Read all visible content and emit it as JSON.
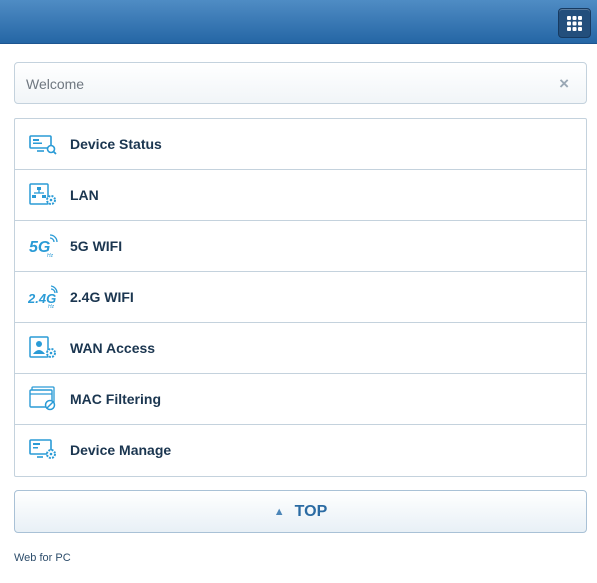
{
  "header": {
    "apps_icon": "grid-icon"
  },
  "welcome": {
    "text": "Welcome",
    "close": "×"
  },
  "menu": {
    "items": [
      {
        "label": "Device Status",
        "icon": "monitor-search-icon"
      },
      {
        "label": "LAN",
        "icon": "lan-gear-icon"
      },
      {
        "label": "5G WIFI",
        "icon": "wifi-5g-icon",
        "icon_text": "5G",
        "icon_sub": "Hz"
      },
      {
        "label": "2.4G WIFI",
        "icon": "wifi-24g-icon",
        "icon_text": "2.4G",
        "icon_sub": "Hz"
      },
      {
        "label": "WAN Access",
        "icon": "user-gear-icon"
      },
      {
        "label": "MAC Filtering",
        "icon": "filter-window-icon"
      },
      {
        "label": "Device Manage",
        "icon": "monitor-gear-icon"
      }
    ]
  },
  "top_button": {
    "arrow": "▲",
    "label": "TOP"
  },
  "footer": {
    "link": "Web for PC"
  },
  "colors": {
    "header": "#2566a5",
    "icon": "#2a9bd6",
    "label": "#1b3650",
    "border": "#c4d2dd"
  }
}
